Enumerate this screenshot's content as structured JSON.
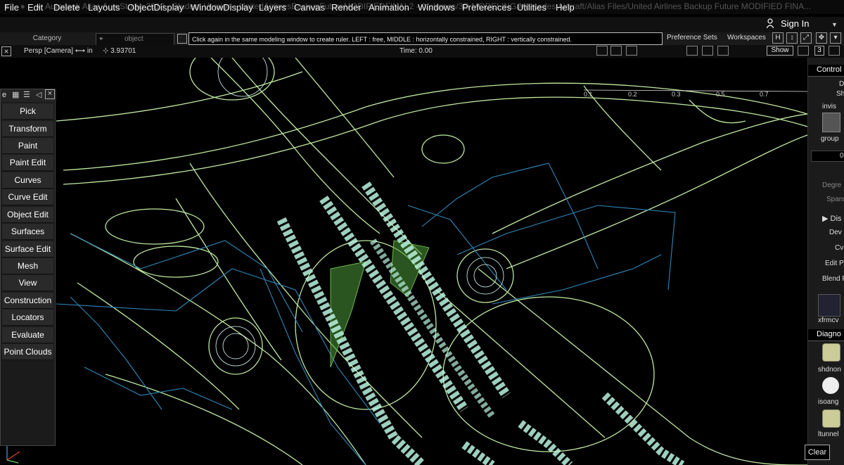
{
  "window": {
    "title": "Autodesk Alias AutoStudio 2018 - Student Version - UnitedAirlinesBackupFutureMODIFIEDFINAL2 - /Volumes/3D MODELING/Mercedes Aircraft/Alias Files/United Airlines Backup Future MODIFIED FINA..."
  },
  "menu": [
    "File",
    "Edit",
    "Delete",
    "Layouts",
    "ObjectDisplay",
    "WindowDisplay",
    "Layers",
    "Canvas",
    "Render",
    "Animation",
    "Windows",
    "Preferences",
    "Utilities",
    "Help"
  ],
  "account": {
    "sign_in": "Sign In"
  },
  "toolbar": {
    "category": "Category",
    "object": "object",
    "message": "Click again in the same modeling window to create ruler.  LEFT : free, MIDDLE : horizontally constrained, RIGHT : vertically constrained.",
    "preference_sets": "Preference Sets",
    "workspaces": "Workspaces"
  },
  "viewbar": {
    "camera": "Persp [Camera] ⟷ in",
    "distance": "3.93701",
    "time": "Time: 0.00",
    "show": "Show",
    "layer_count": "3"
  },
  "viewport": {
    "ruler_ticks": [
      "0.1",
      "0.2",
      "0.3",
      "0.5",
      "0.7"
    ]
  },
  "palette": {
    "title": "e",
    "items": [
      "Pick",
      "Transform",
      "Paint",
      "Paint Edit",
      "Curves",
      "Curve Edit",
      "Object Edit",
      "Surfaces",
      "Surface Edit",
      "Mesh",
      "View",
      "Construction",
      "Locators",
      "Evaluate",
      "Point Clouds"
    ]
  },
  "control_panel": {
    "title": "Control",
    "d": "D",
    "sh": "Sh",
    "invis": "invis",
    "group": "group",
    "zero": "0",
    "degree": "Degre",
    "spans": "Spans",
    "display": "Dis",
    "dev": "Dev",
    "cv": "Cv",
    "edit_p": "Edit P",
    "blend": "Blend P",
    "xfrmcv": "xfrmcv",
    "diagnostic": "Diagno",
    "shdnon": "shdnon",
    "isoang": "isoang",
    "ltunnel": "ltunnel"
  },
  "clear_button": "Clear",
  "colors": {
    "wire_green": "#bfe9a0",
    "wire_blue": "#2f86b8",
    "mint": "#b9f3df",
    "surface_green": "#4f9a3a"
  }
}
